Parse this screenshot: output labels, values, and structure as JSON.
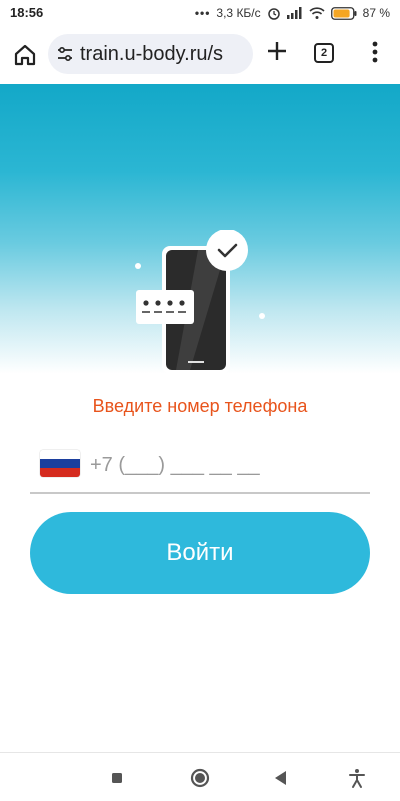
{
  "status_bar": {
    "time": "18:56",
    "net_speed": "3,3 КБ/с",
    "battery_percent": "87 %",
    "battery_level": 0.87
  },
  "browser": {
    "url": "train.u-body.ru/s",
    "tab_count": "2"
  },
  "login": {
    "prompt": "Введите номер телефона",
    "phone_placeholder": "+7 (___) ___ __ __",
    "submit_label": "Войти",
    "accent_color": "#2eb9dc",
    "prompt_color": "#e8541c"
  },
  "icons": [
    "home-icon",
    "site-settings-icon",
    "plus-icon",
    "tabs-icon",
    "menu-icon",
    "alarm-icon",
    "signal-icon",
    "wifi-icon",
    "battery-icon",
    "stop-square-icon",
    "home-circle-icon",
    "back-triangle-icon",
    "accessibility-icon"
  ]
}
